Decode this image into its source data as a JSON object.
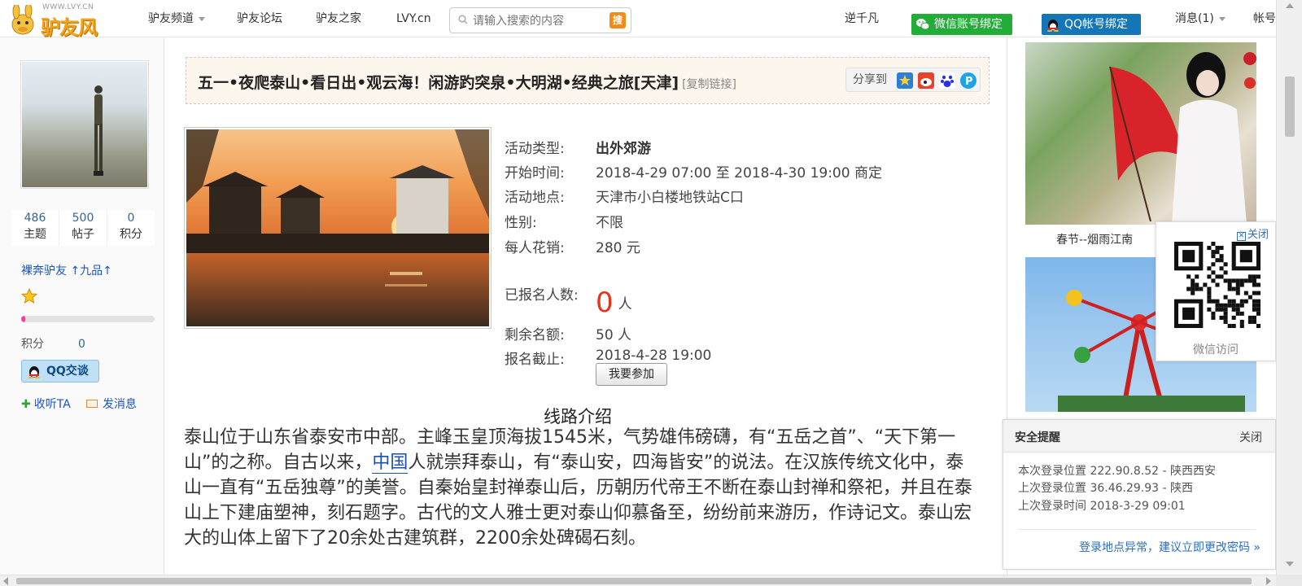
{
  "header": {
    "logo_url_text": "WWW.LVY.CN",
    "logo_name": "驴友风",
    "nav": [
      {
        "label": "驴友频道",
        "has_dropdown": true
      },
      {
        "label": "驴友论坛",
        "has_dropdown": false
      },
      {
        "label": "驴友之家",
        "has_dropdown": false
      },
      {
        "label": "LVY.cn",
        "has_dropdown": false
      }
    ],
    "search": {
      "placeholder": "请输入搜索的内容",
      "button": "搜"
    },
    "username": "逆千凡",
    "wechat_bind": "微信账号绑定",
    "qq_bind": "QQ帐号绑定",
    "messages": "消息(1)",
    "account": "帐号"
  },
  "profile": {
    "stats": [
      {
        "num": "486",
        "label": "主题"
      },
      {
        "num": "500",
        "label": "帖子"
      },
      {
        "num": "0",
        "label": "积分"
      }
    ],
    "rank": "裸奔驴友 ↑九品↑",
    "progress": 0.02,
    "credit_label": "积分",
    "credit_value": "0",
    "qq_chat": "QQ交谈",
    "follow": "收听TA",
    "message": "发消息"
  },
  "event": {
    "title": "五一•夜爬泰山•看日出•观云海！闲游趵突泉•大明湖•经典之旅[天津]",
    "copy_link": "[复制链接]",
    "share_label": "分享到",
    "type_label": "活动类型:",
    "type": "出外郊游",
    "start_label": "开始时间:",
    "start": "2018-4-29 07:00 至 2018-4-30 19:00 商定",
    "place_label": "活动地点:",
    "place": "天津市小白楼地铁站C口",
    "gender_label": "性别:",
    "gender": "不限",
    "cost_label": "每人花销:",
    "cost": "280 元",
    "signed_label": "已报名人数:",
    "signed_count": "0",
    "signed_unit": "人",
    "remain_label": "剩余名额:",
    "remain": "50 人",
    "deadline_label": "报名截止:",
    "deadline": "2018-4-28 19:00",
    "join_button": "我要参加"
  },
  "route": {
    "title": "线路介绍",
    "p_before_link": "泰山位于山东省泰安市中部。主峰玉皇顶海拔1545米，气势雄伟磅礴，有“五岳之首”、“天下第一山”的之称。自古以来，",
    "p_link": "中国",
    "p_after_link": "人就崇拜泰山，有“泰山安，四海皆安”的说法。在汉族传统文化中，泰山一直有“五岳独尊”的美誉。自秦始皇封禅泰山后，历朝历代帝王不断在泰山封禅和祭祀，并且在泰山上下建庙塑神，刻石题字。古代的文人雅士更对泰山仰慕备至，纷纷前来游历，作诗记文。泰山宏大的山体上留下了20余处古建筑群，2200余处碑碣石刻。"
  },
  "sidebar_right": {
    "caption1": "春节--烟雨江南",
    "qr_close": "关闭",
    "qr_caption": "微信访问"
  },
  "safety": {
    "title": "安全提醒",
    "close": "关闭",
    "line1": "本次登录位置 222.90.8.52 - 陕西西安",
    "line2": "上次登录位置 36.46.29.93 - 陕西",
    "line3": "上次登录时间 2018-3-29 09:01",
    "warning": "登录地点异常，建议立即更改密码 »"
  },
  "colors": {
    "accent_orange": "#f08c1a",
    "link_blue": "#1a55c7",
    "wechat_green": "#22ac38",
    "qq_blue": "#1476b6",
    "count_red": "#e6331a"
  }
}
